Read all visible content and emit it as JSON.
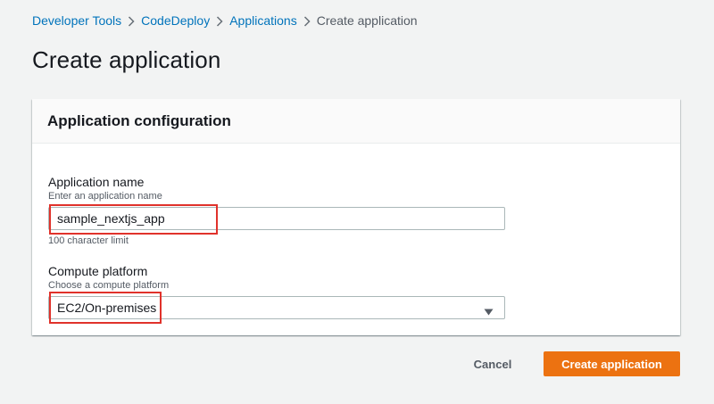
{
  "breadcrumb": {
    "items": [
      {
        "label": "Developer Tools",
        "link": true
      },
      {
        "label": "CodeDeploy",
        "link": true
      },
      {
        "label": "Applications",
        "link": true
      },
      {
        "label": "Create application",
        "link": false
      }
    ]
  },
  "page": {
    "title": "Create application"
  },
  "panel": {
    "title": "Application configuration",
    "app_name": {
      "label": "Application name",
      "description": "Enter an application name",
      "value": "sample_nextjs_app",
      "constraint": "100 character limit"
    },
    "compute_platform": {
      "label": "Compute platform",
      "description": "Choose a compute platform",
      "selected": "EC2/On-premises"
    }
  },
  "actions": {
    "cancel_label": "Cancel",
    "submit_label": "Create application"
  },
  "icons": {
    "breadcrumb_separator": "chevron-right-icon",
    "select_caret": "caret-down-icon"
  },
  "colors": {
    "link": "#0073bb",
    "primary": "#ec7211",
    "highlight": "#e0322b",
    "background": "#f2f3f3"
  }
}
